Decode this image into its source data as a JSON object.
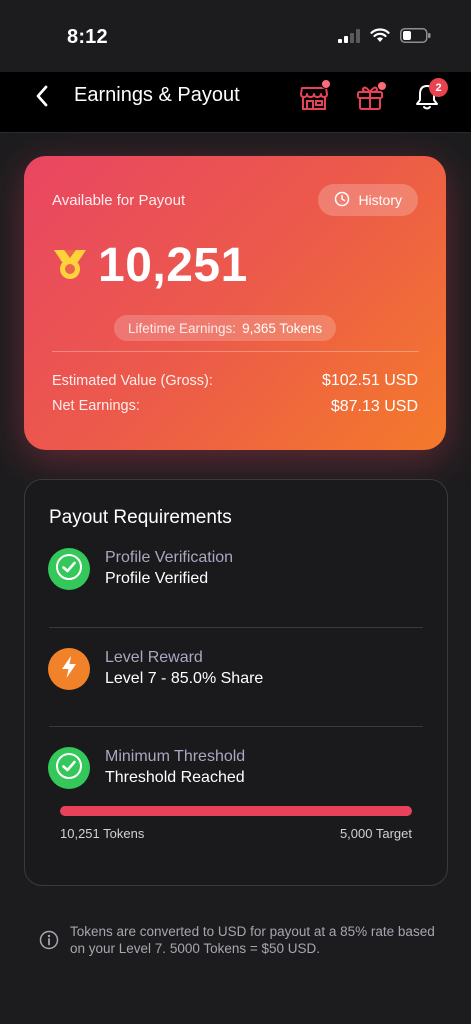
{
  "status_bar": {
    "time": "8:12"
  },
  "header": {
    "title": "Earnings & Payout",
    "notification_count": "2"
  },
  "earnings_card": {
    "available_label": "Available for Payout",
    "history_label": "History",
    "token_amount": "10,251",
    "lifetime_label": "Lifetime Earnings:",
    "lifetime_value": "9,365 Tokens",
    "estimated_label": "Estimated Value (Gross):",
    "estimated_value": "$102.51 USD",
    "net_label": "Net Earnings:",
    "net_value": "$87.13 USD"
  },
  "requirements": {
    "title": "Payout Requirements",
    "items": [
      {
        "label": "Profile Verification",
        "value": "Profile Verified",
        "icon": "check-icon",
        "color": "#34c759"
      },
      {
        "label": "Level Reward",
        "value": "Level 7 - 85.0% Share",
        "icon": "lightning-icon",
        "color": "#f2822a"
      },
      {
        "label": "Minimum Threshold",
        "value": "Threshold Reached",
        "icon": "check-icon",
        "color": "#34c759"
      }
    ],
    "progress": {
      "fraction": 1.0,
      "current_label": "10,251 Tokens",
      "target_label": "5,000 Target",
      "color": "#e8425a"
    }
  },
  "footer_note": "Tokens are converted to USD for payout at a 85% rate based on your Level 7. 5000 Tokens = $50 USD.",
  "colors": {
    "accent_red": "#e94662",
    "accent_orange": "#f47a2a",
    "background": "#1c1c1e"
  }
}
